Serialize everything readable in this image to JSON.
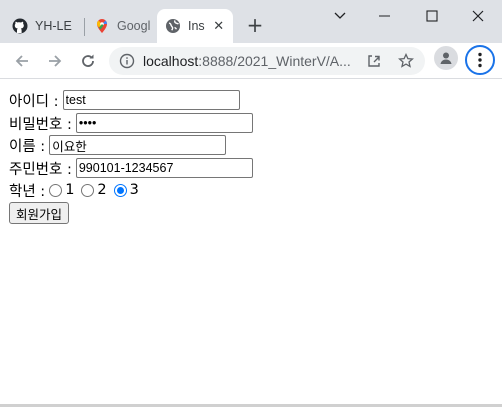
{
  "browser": {
    "tabs": [
      {
        "title": "YH-LE",
        "icon": "github-icon"
      },
      {
        "title": "Googl",
        "icon": "google-maps-icon"
      },
      {
        "title": "Ins",
        "icon": "globe-icon",
        "active": true
      }
    ],
    "close_glyph": "✕",
    "new_tab_glyph": "+",
    "url_host": "localhost",
    "url_rest": ":8888/2021_WinterV/A..."
  },
  "form": {
    "id_label": "아이디 :",
    "id_value": "test",
    "password_label": "비밀번호 :",
    "password_value": "••••",
    "name_label": "이름 :",
    "name_value": "이요한",
    "ssn_label": "주민번호 :",
    "ssn_value": "990101-1234567",
    "grade_label": "학년 :",
    "grade_options": [
      "1",
      "2",
      "3"
    ],
    "grade_selected": "3",
    "submit_label": "회원가입"
  },
  "colors": {
    "accent": "#1a73e8",
    "radio_checked": "#0075ff",
    "titlebar": "#dee1e6"
  }
}
